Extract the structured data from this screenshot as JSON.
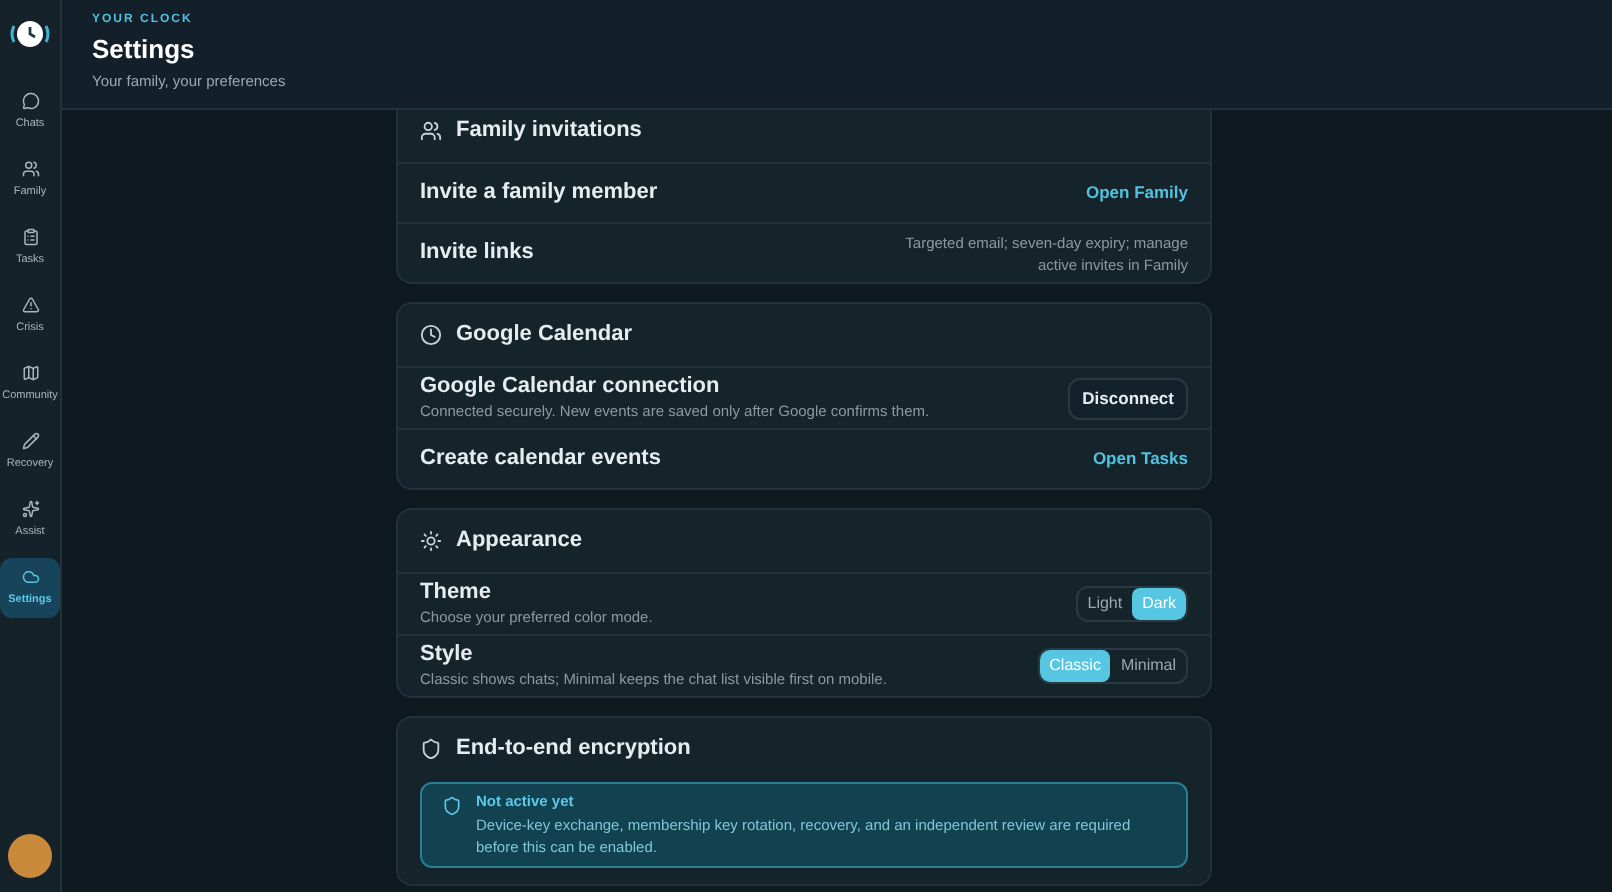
{
  "sidebar": {
    "items": [
      {
        "label": "Chats",
        "selected": false
      },
      {
        "label": "Family",
        "selected": false
      },
      {
        "label": "Tasks",
        "selected": false
      },
      {
        "label": "Crisis",
        "selected": false
      },
      {
        "label": "Community",
        "selected": false
      },
      {
        "label": "Recovery",
        "selected": false
      },
      {
        "label": "Assist",
        "selected": false
      },
      {
        "label": "Settings",
        "selected": true
      }
    ]
  },
  "header": {
    "eyebrow": "YOUR CLOCK",
    "title": "Settings",
    "subtitle": "Your family, your preferences"
  },
  "sections": [
    {
      "kind": "family",
      "title": "Family invitations",
      "rows": [
        {
          "kind": "link",
          "label": "Invite a family member",
          "action": "Open Family"
        },
        {
          "kind": "note",
          "label": "Invite links",
          "note": "Targeted email; seven-day expiry; manage active invites in Family"
        }
      ]
    },
    {
      "kind": "calendar",
      "title": "Google Calendar",
      "rows": [
        {
          "kind": "button",
          "label": "Google Calendar connection",
          "description": "Connected securely. New events are saved only after Google confirms them.",
          "action": "Disconnect"
        },
        {
          "kind": "link",
          "label": "Create calendar events",
          "action": "Open Tasks"
        }
      ]
    },
    {
      "kind": "appearance",
      "title": "Appearance",
      "rows": [
        {
          "kind": "segmented",
          "label": "Theme",
          "description": "Choose your preferred color mode.",
          "options": [
            {
              "label": "Light",
              "selected": false
            },
            {
              "label": "Dark",
              "selected": true
            }
          ]
        },
        {
          "kind": "segmented",
          "label": "Style",
          "description": "Classic shows chats; Minimal keeps the chat list visible first on mobile.",
          "options": [
            {
              "label": "Classic",
              "selected": true
            },
            {
              "label": "Minimal",
              "selected": false
            }
          ]
        }
      ]
    },
    {
      "kind": "encryption",
      "title": "End-to-end encryption",
      "alert": {
        "title": "Not active yet",
        "text": "Device-key exchange, membership key rotation, recovery, and an independent review are required before this can be enabled."
      }
    }
  ]
}
